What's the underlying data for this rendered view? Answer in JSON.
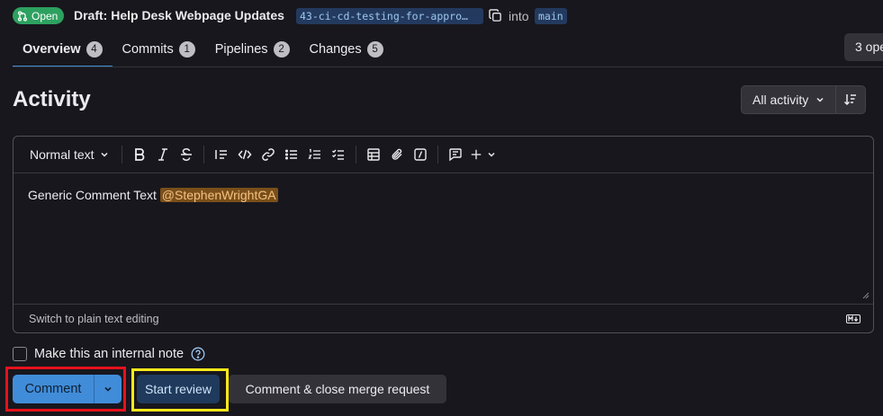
{
  "header": {
    "status": "Open",
    "title": "Draft: Help Desk Webpage Updates",
    "source_branch": "43-ci-cd-testing-for-appro…",
    "into": "into",
    "target_branch": "main"
  },
  "tabs": [
    {
      "label": "Overview",
      "count": "4"
    },
    {
      "label": "Commits",
      "count": "1"
    },
    {
      "label": "Pipelines",
      "count": "2"
    },
    {
      "label": "Changes",
      "count": "5"
    }
  ],
  "threads_button": "3 ope",
  "activity": {
    "title": "Activity",
    "filter_label": "All activity"
  },
  "editor": {
    "text_style": "Normal text",
    "content_text": "Generic Comment Text ",
    "mention": "@StephenWrightGA",
    "switch_link": "Switch to plain text editing"
  },
  "note": {
    "label": "Make this an internal note"
  },
  "actions": {
    "comment": "Comment",
    "start_review": "Start review",
    "comment_close": "Comment & close merge request"
  },
  "colors": {
    "background": "#18171d",
    "status_green": "#2da160",
    "accent_blue": "#418cd8",
    "highlight_red": "#e6111d",
    "highlight_yellow": "#ffe81a"
  }
}
